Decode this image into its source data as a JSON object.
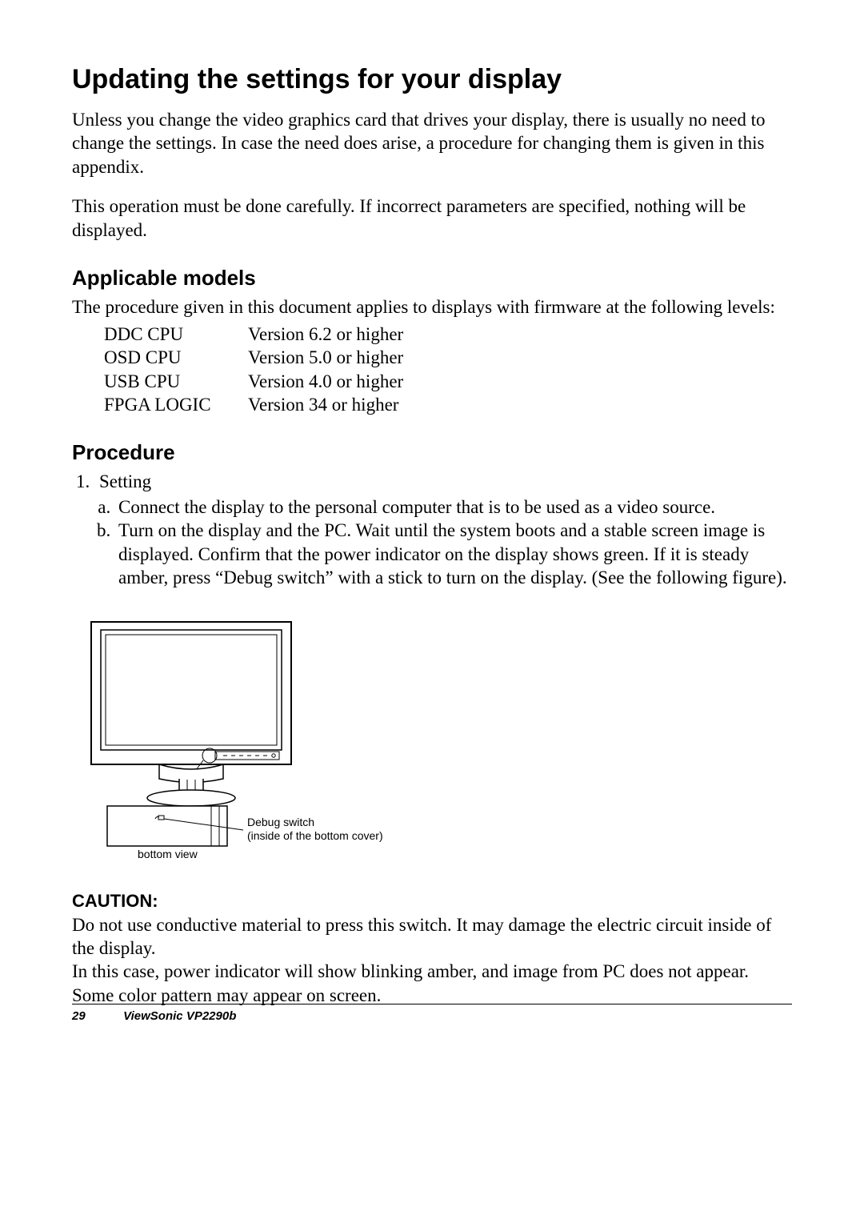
{
  "title": "Updating the settings for your display",
  "p1": "Unless you change the video graphics card that drives your display, there is usually no need to change the settings. In case the need does arise, a procedure for changing them is given in this appendix.",
  "p2": "This operation must be done carefully. If incorrect parameters are specified, nothing will be displayed.",
  "h2_models": "Applicable models",
  "models_intro": "The procedure given in this document applies to displays with firmware at the following levels:",
  "firmware": [
    {
      "name": "DDC CPU",
      "ver": "Version 6.2 or higher"
    },
    {
      "name": "OSD CPU",
      "ver": "Version 5.0 or higher"
    },
    {
      "name": "USB CPU",
      "ver": "Version 4.0 or higher"
    },
    {
      "name": "FPGA LOGIC",
      "ver": "Version 34 or higher"
    }
  ],
  "h2_procedure": "Procedure",
  "step1_title": "Setting",
  "step1a": "Connect the display to the personal computer that is to be used as a video source.",
  "step1b": "Turn on the display and the PC. Wait until the system boots and a stable screen image is displayed. Confirm that the power indicator on the display shows green. If it is steady amber, press “Debug switch” with a stick to turn on the display. (See the following figure).",
  "figure": {
    "label1": "Debug switch",
    "label2": "(inside of the bottom cover)",
    "bottom_label": "bottom view"
  },
  "caution_head": "CAUTION:",
  "caution1": "Do not use conductive material to press this switch. It may damage the electric circuit inside of the display.",
  "caution2": "In this case, power indicator will show blinking amber, and image from PC does not appear.",
  "caution3": "Some color pattern may appear on screen.",
  "footer": {
    "page": "29",
    "brand": "ViewSonic",
    "model": "VP2290b"
  }
}
